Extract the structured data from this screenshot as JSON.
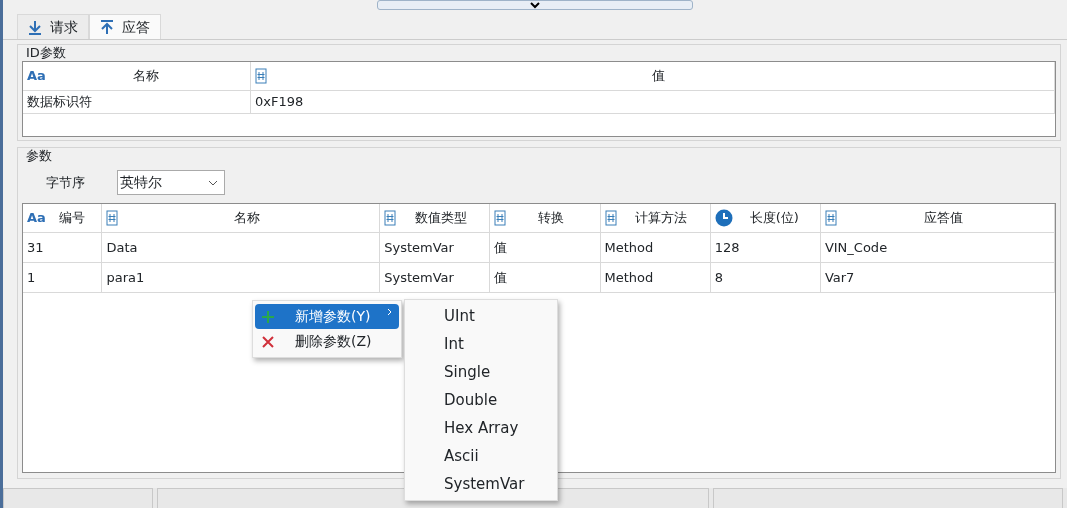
{
  "tabs": [
    {
      "label": "请求",
      "kind": "down",
      "selected": false
    },
    {
      "label": "应答",
      "kind": "up",
      "selected": true
    }
  ],
  "id_group": {
    "title": "ID参数",
    "columns": [
      {
        "kind": "text",
        "icon_text": "Aa",
        "label": "名称"
      },
      {
        "kind": "number",
        "label": "值"
      }
    ],
    "rows": [
      [
        "数据标识符",
        "0xF198"
      ]
    ]
  },
  "param_group": {
    "title": "参数",
    "byte_order_label": "字节序",
    "byte_order_value": "英特尔",
    "columns": [
      {
        "kind": "text",
        "icon_text": "Aa",
        "label": "编号"
      },
      {
        "kind": "number",
        "label": "名称"
      },
      {
        "kind": "number",
        "label": "数值类型"
      },
      {
        "kind": "number",
        "label": "转换"
      },
      {
        "kind": "number",
        "label": "计算方法"
      },
      {
        "kind": "time",
        "label": "长度(位)"
      },
      {
        "kind": "number",
        "label": "应答值"
      }
    ],
    "rows": [
      [
        "31",
        "Data",
        "SystemVar",
        "值",
        "Method",
        "128",
        "VIN_Code"
      ],
      [
        "1",
        "para1",
        "SystemVar",
        "值",
        "Method",
        "8",
        "Var7"
      ]
    ]
  },
  "context_menu": [
    {
      "label": "新增参数(Y)",
      "kind": "add",
      "selected": true,
      "submenu": true
    },
    {
      "label": "删除参数(Z)",
      "kind": "delete",
      "selected": false,
      "submenu": false
    }
  ],
  "submenu": [
    "UInt",
    "Int",
    "Single",
    "Double",
    "Hex Array",
    "Ascii",
    "SystemVar"
  ]
}
